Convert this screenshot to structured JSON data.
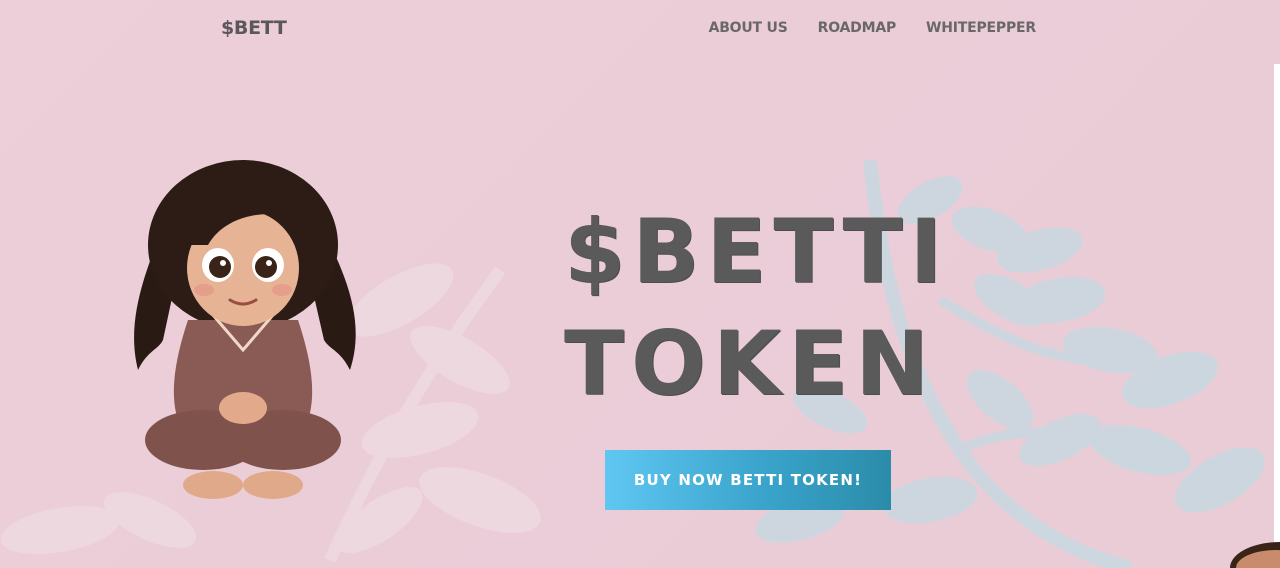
{
  "header": {
    "brand": "$BETT",
    "nav": [
      {
        "label": "ABOUT US"
      },
      {
        "label": "ROADMAP"
      },
      {
        "label": "WHITEPEPPER"
      }
    ]
  },
  "hero": {
    "title_line1": "$BETTI",
    "title_line2": "TOKEN",
    "cta_label": "BUY NOW BETTI TOKEN!",
    "character_icon": "girl-in-pajamas-illustration"
  },
  "colors": {
    "background": "#eccfd9",
    "text": "#5a5a5b",
    "button_start": "#5fc7f2",
    "button_end": "#2b8ca9",
    "leaf": "#c9d9e1"
  }
}
